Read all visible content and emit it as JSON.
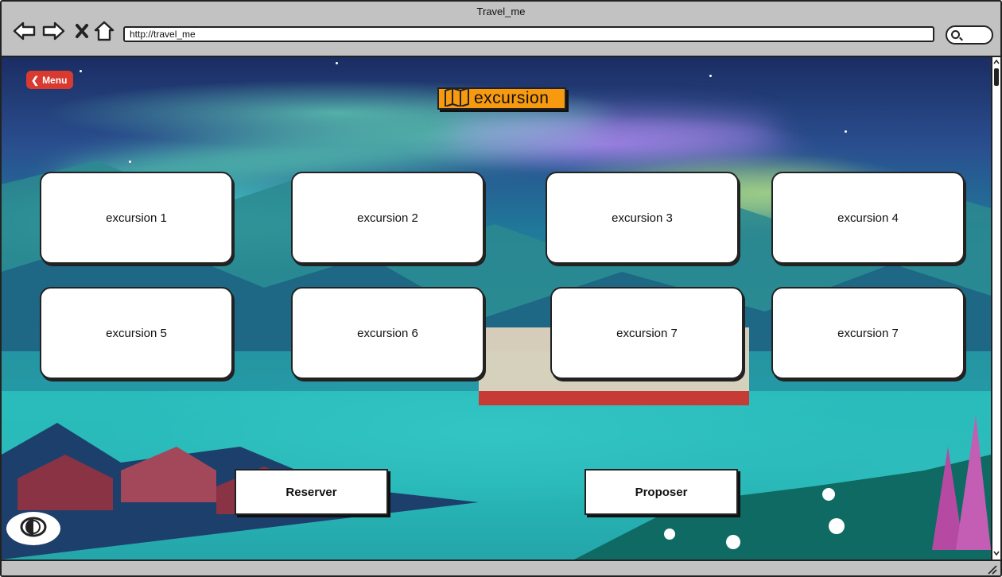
{
  "window": {
    "title": "Travel_me",
    "url": "http://travel_me"
  },
  "nav": {
    "back_icon": "arrow-left-icon",
    "forward_icon": "arrow-right-icon",
    "close_icon": "close-icon",
    "home_icon": "home-icon",
    "search_icon": "search-icon"
  },
  "menu": {
    "label": "Menu",
    "icon": "chevron-left-icon",
    "color": "#d93a30"
  },
  "page": {
    "title": "excursion",
    "title_icon": "map-icon",
    "accent": "#f79a10"
  },
  "excursions": [
    {
      "label": "excursion 1"
    },
    {
      "label": "excursion 2"
    },
    {
      "label": "excursion 3"
    },
    {
      "label": "excursion 4"
    },
    {
      "label": "excursion 5"
    },
    {
      "label": "excursion 6"
    },
    {
      "label": "excursion 7"
    },
    {
      "label": "excursion 7"
    }
  ],
  "actions": {
    "reserve_label": "Reserver",
    "propose_label": "Proposer"
  },
  "accessibility": {
    "contrast_icon": "contrast-toggle-icon"
  }
}
